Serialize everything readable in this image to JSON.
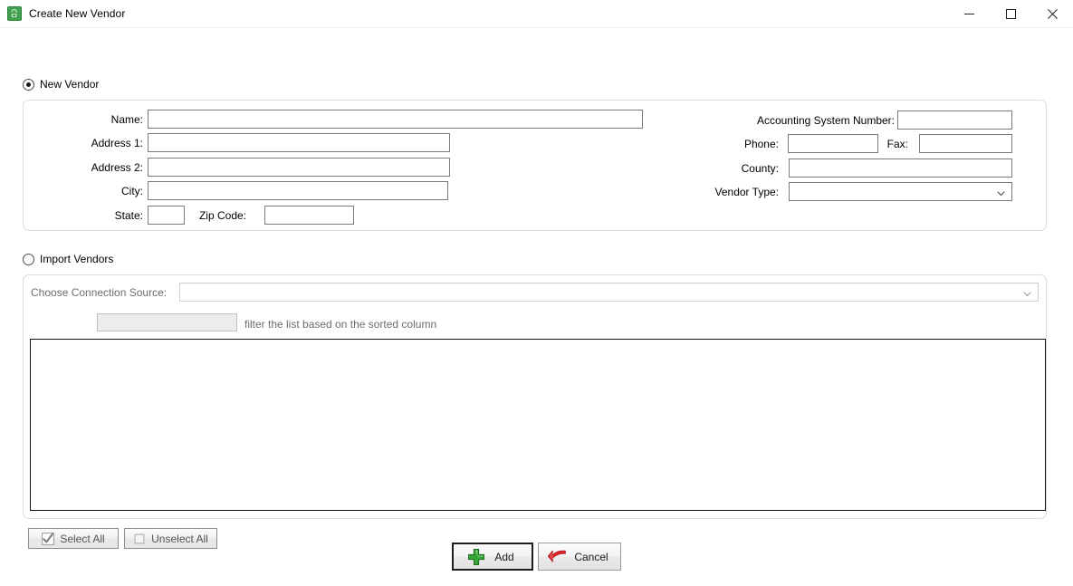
{
  "window": {
    "title": "Create New Vendor",
    "icon": "vendor-app-icon",
    "controls": {
      "minimize": "minimize-icon",
      "maximize": "maximize-icon",
      "close": "close-icon"
    }
  },
  "colors": {
    "app_icon_green": "#3fa34d",
    "add_plus_green": "#34a532",
    "cancel_arrow_red": "#d8232a",
    "field_border": "#7a7a7a",
    "panel_border": "#dcdcdc",
    "listbox_border": "#111111",
    "disabled_text": "#6d6d6d"
  },
  "new_vendor": {
    "radio_label": "New Vendor",
    "selected": true,
    "fields": {
      "name": {
        "label": "Name:",
        "value": "",
        "placeholder": ""
      },
      "address1": {
        "label": "Address 1:",
        "value": "",
        "placeholder": ""
      },
      "address2": {
        "label": "Address 2:",
        "value": "",
        "placeholder": ""
      },
      "city": {
        "label": "City:",
        "value": "",
        "placeholder": ""
      },
      "state": {
        "label": "State:",
        "value": "",
        "placeholder": ""
      },
      "zip": {
        "label": "Zip Code:",
        "value": "",
        "placeholder": ""
      },
      "accounting_system_number": {
        "label": "Accounting System Number:",
        "value": "",
        "placeholder": ""
      },
      "phone": {
        "label": "Phone:",
        "value": "",
        "placeholder": ""
      },
      "fax": {
        "label": "Fax:",
        "value": "",
        "placeholder": ""
      },
      "county": {
        "label": "County:",
        "value": "",
        "placeholder": ""
      },
      "vendor_type": {
        "label": "Vendor Type:",
        "value": "",
        "options": []
      }
    }
  },
  "import_vendors": {
    "radio_label": "Import Vendors",
    "selected": false,
    "connection_source": {
      "label": "Choose Connection Source:",
      "value": "",
      "options": []
    },
    "filter": {
      "value": "",
      "hint": "filter the list based on the sorted column"
    },
    "list": {
      "items": []
    },
    "select_all": {
      "label": "Select All",
      "icon": "checked-checkbox-icon"
    },
    "unselect_all": {
      "label": "Unselect All",
      "icon": "empty-checkbox-icon"
    }
  },
  "actions": {
    "add": {
      "label": "Add",
      "icon": "green-plus-icon",
      "is_default": true
    },
    "cancel": {
      "label": "Cancel",
      "icon": "red-undo-arrow-icon",
      "is_default": false
    }
  }
}
